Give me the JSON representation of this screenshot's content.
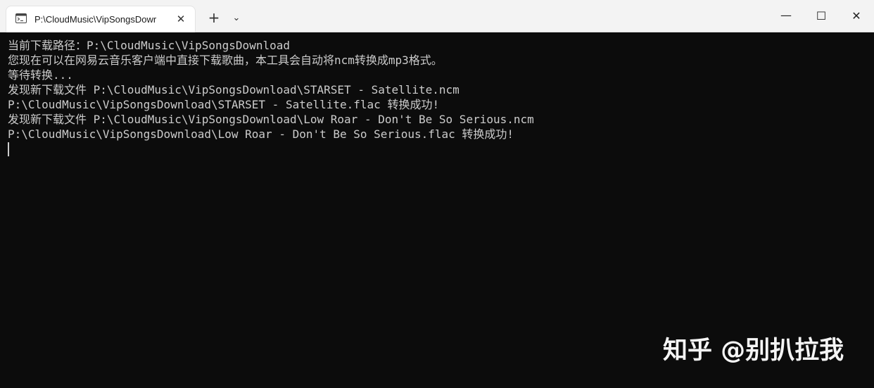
{
  "window": {
    "tab_title": "P:\\CloudMusic\\VipSongsDowr",
    "tab_close": "✕",
    "new_tab": "+",
    "dropdown": "⌄",
    "minimize": "—",
    "maximize": "☐",
    "close": "✕"
  },
  "terminal": {
    "lines": [
      "当前下载路径：P:\\CloudMusic\\VipSongsDownload",
      "您现在可以在网易云音乐客户端中直接下载歌曲，本工具会自动将ncm转换成mp3格式。",
      "等待转换...",
      "发现新下载文件 P:\\CloudMusic\\VipSongsDownload\\STARSET - Satellite.ncm",
      "P:\\CloudMusic\\VipSongsDownload\\STARSET - Satellite.flac 转换成功!",
      "发现新下载文件 P:\\CloudMusic\\VipSongsDownload\\Low Roar - Don't Be So Serious.ncm",
      "P:\\CloudMusic\\VipSongsDownload\\Low Roar - Don't Be So Serious.flac 转换成功!"
    ]
  },
  "watermark": "知乎 @别扒拉我",
  "icons": {
    "tab": "terminal-icon"
  },
  "colors": {
    "terminal_bg": "#0c0c0c",
    "terminal_fg": "#cccccc",
    "titlebar_bg": "#f3f3f3"
  }
}
